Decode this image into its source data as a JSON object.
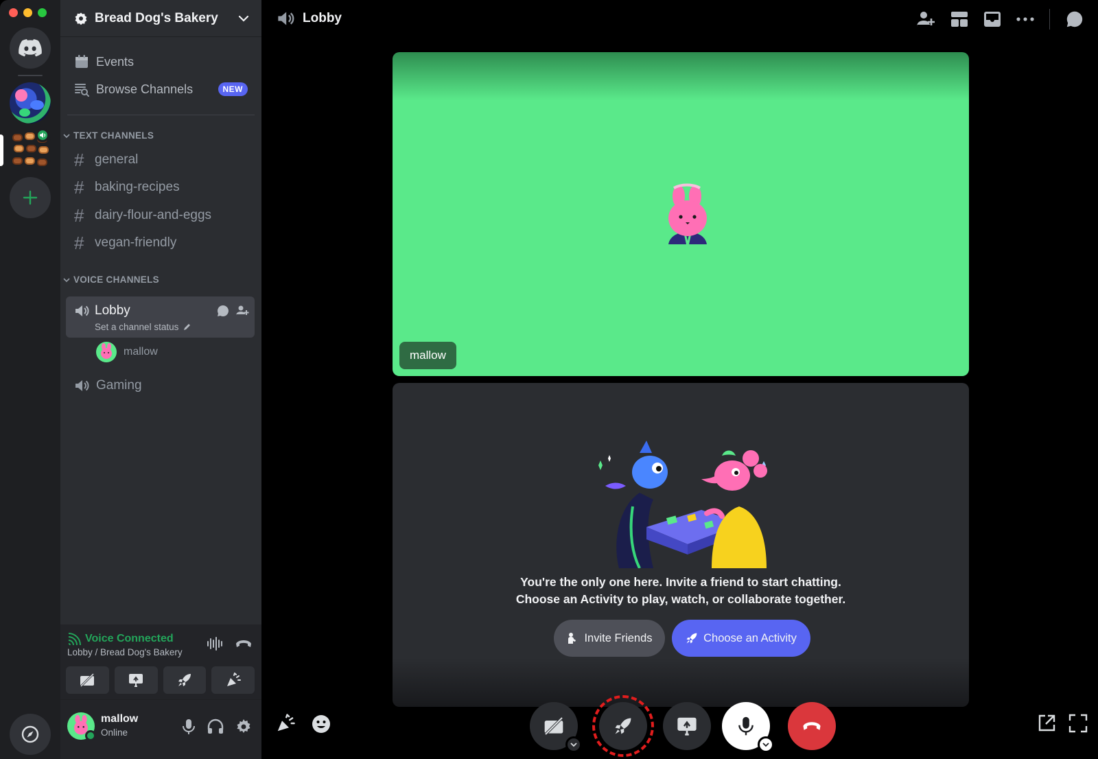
{
  "server": {
    "name": "Bread Dog's Bakery"
  },
  "sidebar": {
    "events_label": "Events",
    "browse_label": "Browse Channels",
    "browse_badge": "NEW",
    "text_category": "TEXT CHANNELS",
    "text_channels": [
      "general",
      "baking-recipes",
      "dairy-flour-and-eggs",
      "vegan-friendly"
    ],
    "voice_category": "VOICE CHANNELS",
    "lobby": {
      "name": "Lobby",
      "status_placeholder": "Set a channel status",
      "user": "mallow"
    },
    "gaming": "Gaming"
  },
  "voice_panel": {
    "status": "Voice Connected",
    "location": "Lobby / Bread Dog's Bakery"
  },
  "user_panel": {
    "name": "mallow",
    "status": "Online"
  },
  "call": {
    "channel_title": "Lobby",
    "tile_name": "mallow",
    "message_line1": "You're the only one here. Invite a friend to start chatting.",
    "message_line2": "Choose an Activity to play, watch, or collaborate together.",
    "invite_label": "Invite Friends",
    "activity_label": "Choose an Activity"
  },
  "colors": {
    "accent": "#5865f2",
    "online": "#23a55a",
    "speaking_tile": "#5ae98a",
    "hangup": "#da373c",
    "highlight_ring": "#e11d1d"
  },
  "icons": [
    "discord-logo-icon",
    "calendar-icon",
    "browse-channels-icon",
    "hash-icon",
    "speaker-icon",
    "chat-bubble-icon",
    "add-member-icon",
    "pencil-icon",
    "signal-icon",
    "soundwave-icon",
    "phone-icon",
    "camera-off-icon",
    "screen-share-icon",
    "rocket-icon",
    "soundboard-icon",
    "mic-icon",
    "headphones-icon",
    "gear-icon",
    "grid-layout-icon",
    "inbox-icon",
    "more-icon",
    "emoji-icon",
    "popout-icon",
    "fullscreen-icon",
    "compass-icon",
    "plus-icon",
    "chevron-down-icon"
  ]
}
